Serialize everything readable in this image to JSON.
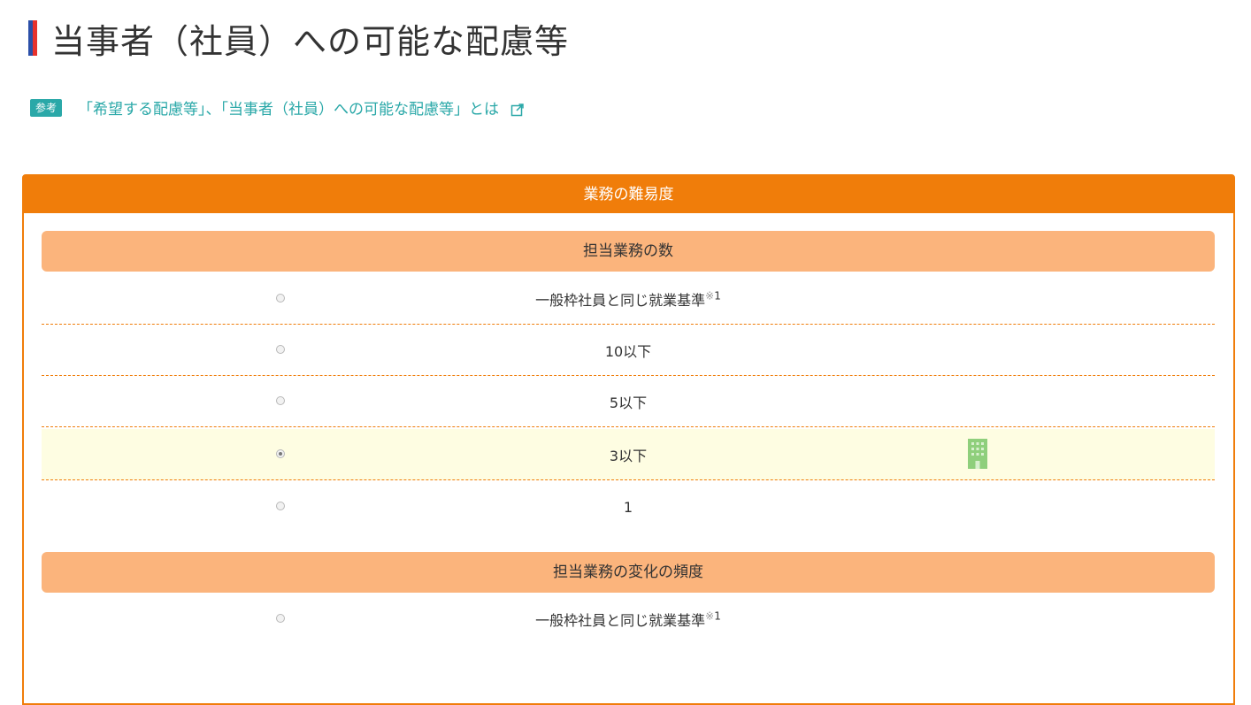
{
  "page": {
    "title": "当事者（社員）への可能な配慮等"
  },
  "reference": {
    "badge": "参考",
    "link_text": "「希望する配慮等」、「当事者（社員）への可能な配慮等」とは"
  },
  "panel": {
    "header": "業務の難易度",
    "sections": [
      {
        "title": "担当業務の数",
        "options": [
          {
            "label": "一般枠社員と同じ就業基準",
            "note": "※",
            "note_num": "1",
            "selected": false
          },
          {
            "label": "10以下",
            "selected": false
          },
          {
            "label": "5以下",
            "selected": false
          },
          {
            "label": "3以下",
            "selected": true
          },
          {
            "label": "1",
            "selected": false
          }
        ]
      },
      {
        "title": "担当業務の変化の頻度",
        "options": [
          {
            "label": "一般枠社員と同じ就業基準",
            "note": "※",
            "note_num": "1",
            "selected": false
          }
        ]
      }
    ]
  },
  "colors": {
    "accent_orange": "#f07d0a",
    "section_orange": "#fbb47c",
    "selected_bg": "#fefde2",
    "ref_teal": "#2aa8a8"
  },
  "icons": {
    "title_marker": "bicolor-bar",
    "external_link": "external-link-icon",
    "building": "building-icon"
  }
}
